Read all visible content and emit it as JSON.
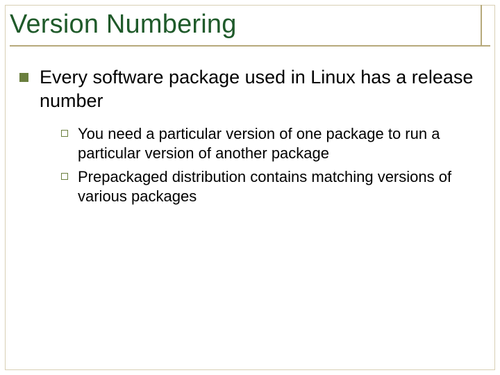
{
  "slide": {
    "title": "Version Numbering",
    "bullets": [
      {
        "text": "Every software package used in Linux has a release number",
        "children": [
          {
            "text": "You need a particular version of one package to run a particular version of another package"
          },
          {
            "text": "Prepackaged distribution contains matching versions of various packages"
          }
        ]
      }
    ]
  }
}
